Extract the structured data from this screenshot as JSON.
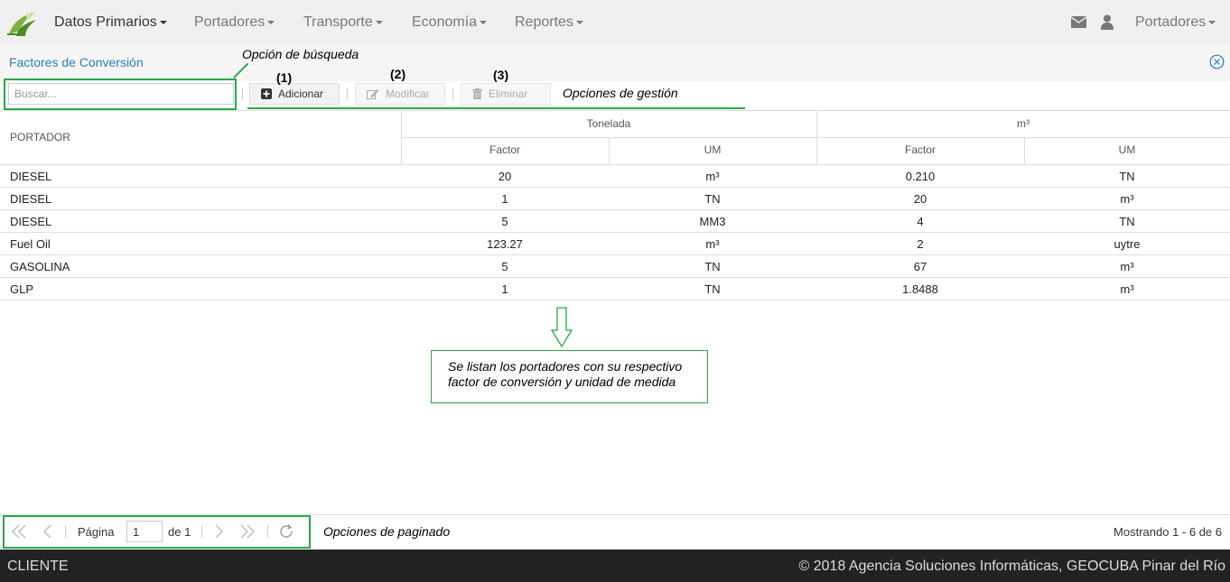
{
  "nav": {
    "items": [
      {
        "label": "Datos Primarios",
        "active": true
      },
      {
        "label": "Portadores",
        "active": false
      },
      {
        "label": "Transporte",
        "active": false
      },
      {
        "label": "Economía",
        "active": false
      },
      {
        "label": "Reportes",
        "active": false
      }
    ],
    "user_menu_label": "Portadores",
    "icons": [
      "mail-icon",
      "user-icon"
    ]
  },
  "panel": {
    "title": "Factores de Conversión"
  },
  "toolbar": {
    "search_placeholder": "Buscar...",
    "add_label": "Adicionar",
    "edit_label": "Modificar",
    "delete_label": "Eliminar"
  },
  "annotations": {
    "search_note": "Opción de búsqueda",
    "manage_note": "Opciones de gestión",
    "num_1": "(1)",
    "num_2": "(2)",
    "num_3": "(3)",
    "list_note_line1": "Se listan los portadores con su respectivo",
    "list_note_line2": "factor de conversión y unidad de medida",
    "paging_note": "Opciones de paginado"
  },
  "table": {
    "col_portador": "PORTADOR",
    "group_1": "Tonelada",
    "group_2": "m³",
    "sub_factor": "Factor",
    "sub_um": "UM",
    "rows": [
      [
        "DIESEL",
        "20",
        "m³",
        "0.210",
        "TN"
      ],
      [
        "DIESEL",
        "1",
        "TN",
        "20",
        "m³"
      ],
      [
        "DIESEL",
        "5",
        "MM3",
        "4",
        "TN"
      ],
      [
        "Fuel Oil",
        "123.27",
        "m³",
        "2",
        "uytre"
      ],
      [
        "GASOLINA",
        "5",
        "TN",
        "67",
        "m³"
      ],
      [
        "GLP",
        "1",
        "TN",
        "1.8488",
        "m³"
      ]
    ]
  },
  "pager": {
    "page_label": "Página",
    "page_value": "1",
    "of_label": "de 1",
    "display_msg": "Mostrando 1 - 6 de 6"
  },
  "footer": {
    "left": "CLIENTE",
    "right": "© 2018 Agencia Soluciones Informáticas, GEOCUBA Pinar del Río"
  },
  "colors": {
    "accent_green": "#2aa84a",
    "title_blue": "#2b7dbc",
    "footer_bg": "#222222"
  }
}
